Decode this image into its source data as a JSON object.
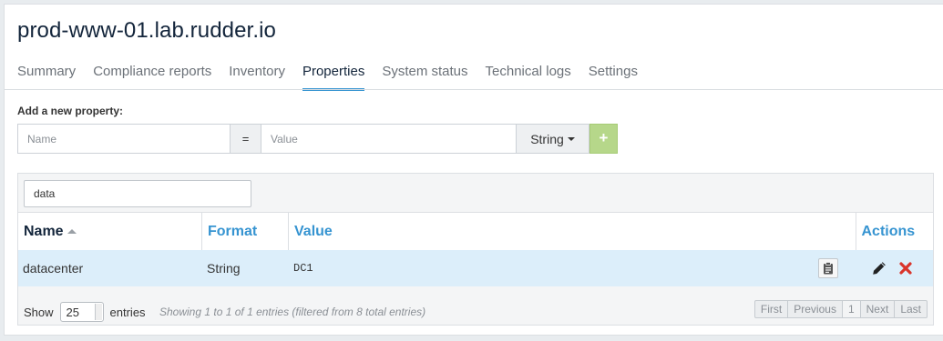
{
  "header": {
    "title": "prod-www-01.lab.rudder.io"
  },
  "tabs": [
    {
      "label": "Summary",
      "active": false
    },
    {
      "label": "Compliance reports",
      "active": false
    },
    {
      "label": "Inventory",
      "active": false
    },
    {
      "label": "Properties",
      "active": true
    },
    {
      "label": "System status",
      "active": false
    },
    {
      "label": "Technical logs",
      "active": false
    },
    {
      "label": "Settings",
      "active": false
    }
  ],
  "add_property": {
    "label": "Add a new property:",
    "name_placeholder": "Name",
    "equals": "=",
    "value_placeholder": "Value",
    "type": "String",
    "add_icon": "plus-icon"
  },
  "table": {
    "filter_value": "data",
    "columns": [
      {
        "label": "Name",
        "sorted": "asc"
      },
      {
        "label": "Format"
      },
      {
        "label": "Value"
      },
      {
        "label": "Actions"
      }
    ],
    "rows": [
      {
        "name": "datacenter",
        "format": "String",
        "value": "DC1"
      }
    ],
    "footer": {
      "show_label": "Show",
      "page_length": "25",
      "entries_label": "entries",
      "info": "Showing 1 to 1 of 1 entries (filtered from 8 total entries)",
      "pagination": [
        "First",
        "Previous",
        "1",
        "Next",
        "Last"
      ]
    }
  },
  "colors": {
    "accent": "#3694d1",
    "add_button": "#b6d78a",
    "row_highlight": "#dceefa",
    "delete": "#d9342b"
  },
  "icons": {
    "copy": "clipboard-icon",
    "edit": "pencil-icon",
    "delete": "close-icon"
  }
}
